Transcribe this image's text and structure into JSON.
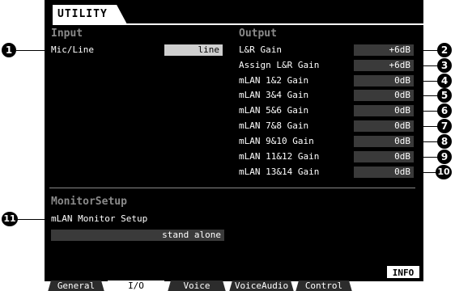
{
  "window": {
    "title": "UTILITY"
  },
  "input": {
    "heading": "Input",
    "mic_line_label": "Mic/Line",
    "mic_line_value": "line"
  },
  "output": {
    "heading": "Output",
    "rows": [
      {
        "label": "L&R Gain",
        "value": "+6dB"
      },
      {
        "label": "Assign L&R Gain",
        "value": "+6dB"
      },
      {
        "label": "mLAN 1&2 Gain",
        "value": "0dB"
      },
      {
        "label": "mLAN 3&4 Gain",
        "value": "0dB"
      },
      {
        "label": "mLAN 5&6 Gain",
        "value": "0dB"
      },
      {
        "label": "mLAN 7&8 Gain",
        "value": "0dB"
      },
      {
        "label": "mLAN 9&10 Gain",
        "value": "0dB"
      },
      {
        "label": "mLAN 11&12 Gain",
        "value": "0dB"
      },
      {
        "label": "mLAN 13&14 Gain",
        "value": "0dB"
      }
    ]
  },
  "monitor": {
    "heading": "MonitorSetup",
    "label": "mLAN Monitor Setup",
    "value": "stand alone"
  },
  "info_button": "INFO",
  "tabs": [
    "General",
    "I/O",
    "Voice",
    "VoiceAudio",
    "Control"
  ],
  "active_tab": "I/O",
  "callouts": [
    "1",
    "2",
    "3",
    "4",
    "5",
    "6",
    "7",
    "8",
    "9",
    "10",
    "11"
  ]
}
